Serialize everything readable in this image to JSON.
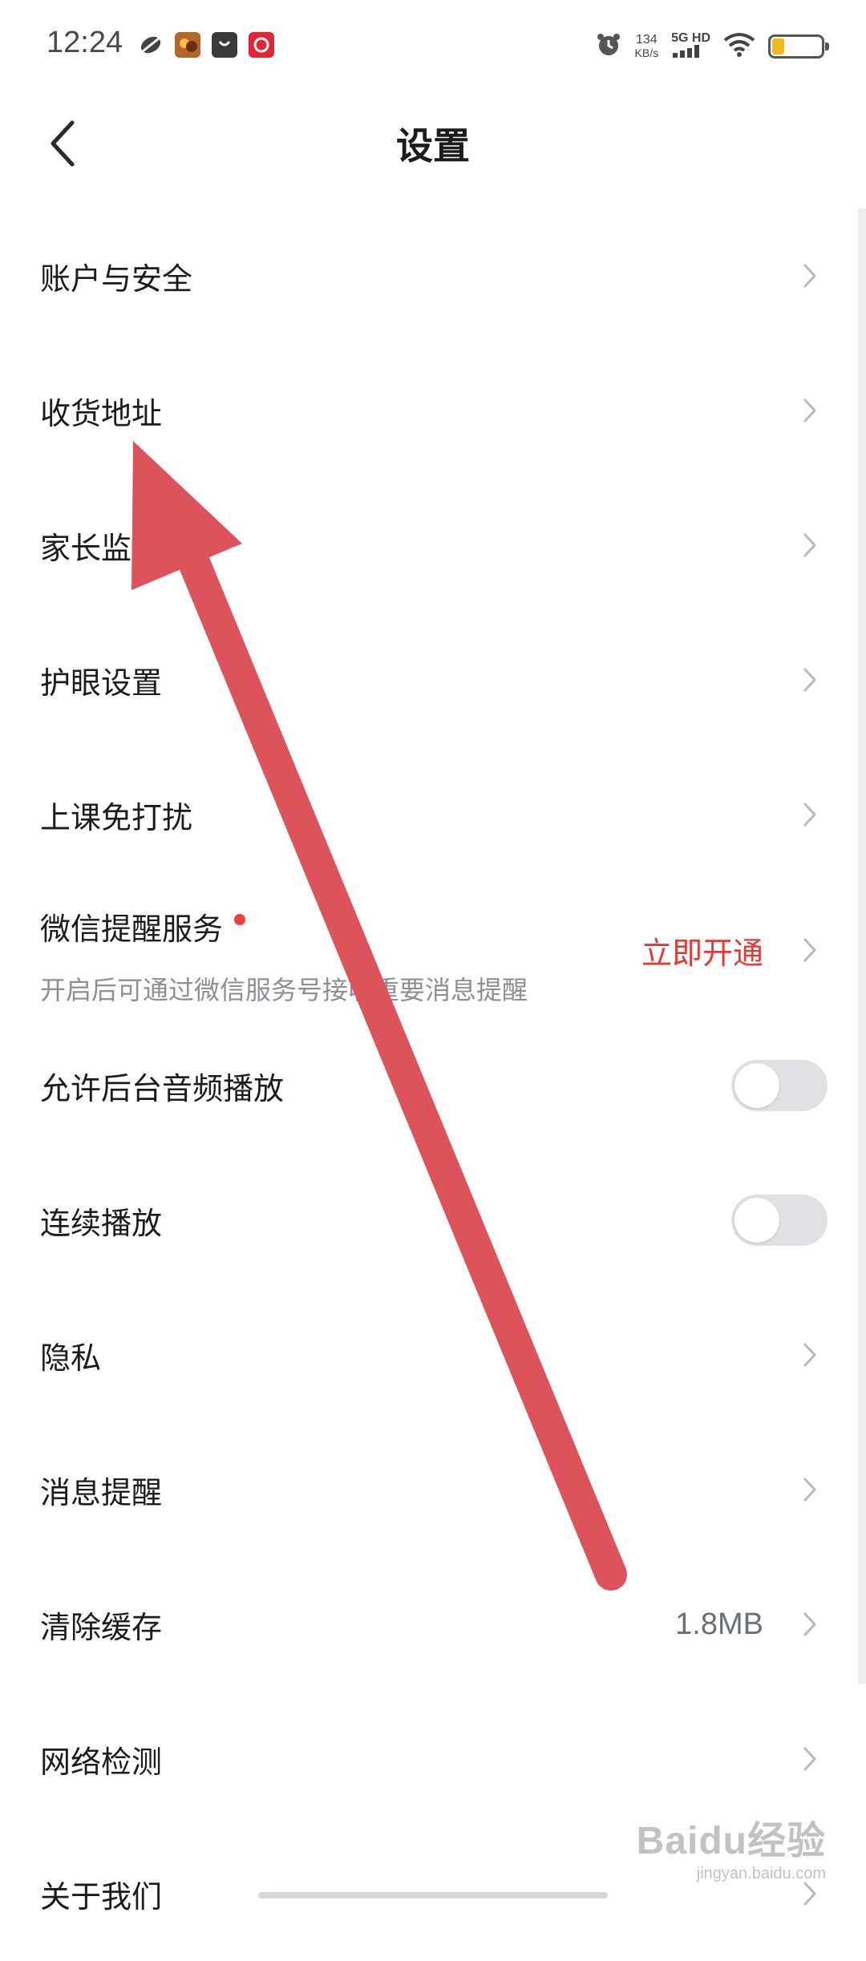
{
  "status_bar": {
    "time": "12:24",
    "app_icons": [
      {
        "icon": "leaf-app-icon",
        "color": "#333333"
      },
      {
        "icon": "game-app-icon",
        "color": "#b5652a"
      },
      {
        "icon": "bag-app-icon",
        "color": "#333333"
      },
      {
        "icon": "red-app-icon",
        "color": "#e0243a"
      }
    ],
    "speed_value": "134",
    "speed_unit": "KB/s",
    "network": "5G HD",
    "icons": [
      "alarm-icon",
      "signal-icon",
      "wifi-icon",
      "battery-icon"
    ],
    "battery_level": 0.25
  },
  "header": {
    "back_icon": "chevron-left-icon",
    "title": "设置"
  },
  "settings": [
    {
      "label": "账户与安全",
      "type": "link"
    },
    {
      "label": "收货地址",
      "type": "link"
    },
    {
      "label": "家长监",
      "type": "link"
    },
    {
      "label": "护眼设置",
      "type": "link"
    },
    {
      "label": "上课免打扰",
      "type": "link"
    },
    {
      "label": "微信提醒服务",
      "type": "link",
      "subtitle": "开启后可通过微信服务号接收重要消息提醒",
      "value": "立即开通",
      "badge": "red-dot"
    },
    {
      "label": "允许后台音频播放",
      "type": "toggle",
      "on": false
    },
    {
      "label": "连续播放",
      "type": "toggle",
      "on": false
    },
    {
      "label": "隐私",
      "type": "link"
    },
    {
      "label": "消息提醒",
      "type": "link"
    },
    {
      "label": "清除缓存",
      "type": "link",
      "value": "1.8MB"
    },
    {
      "label": "网络检测",
      "type": "link"
    },
    {
      "label": "关于我们",
      "type": "link"
    }
  ],
  "watermark": {
    "logo": "Baidu经验",
    "url": "jingyan.baidu.com"
  },
  "colors": {
    "accent_red": "#e53935",
    "annotation_arrow": "#dc535c",
    "toggle_off": "#e1e1e3",
    "chevron": "#b8b8bd"
  }
}
